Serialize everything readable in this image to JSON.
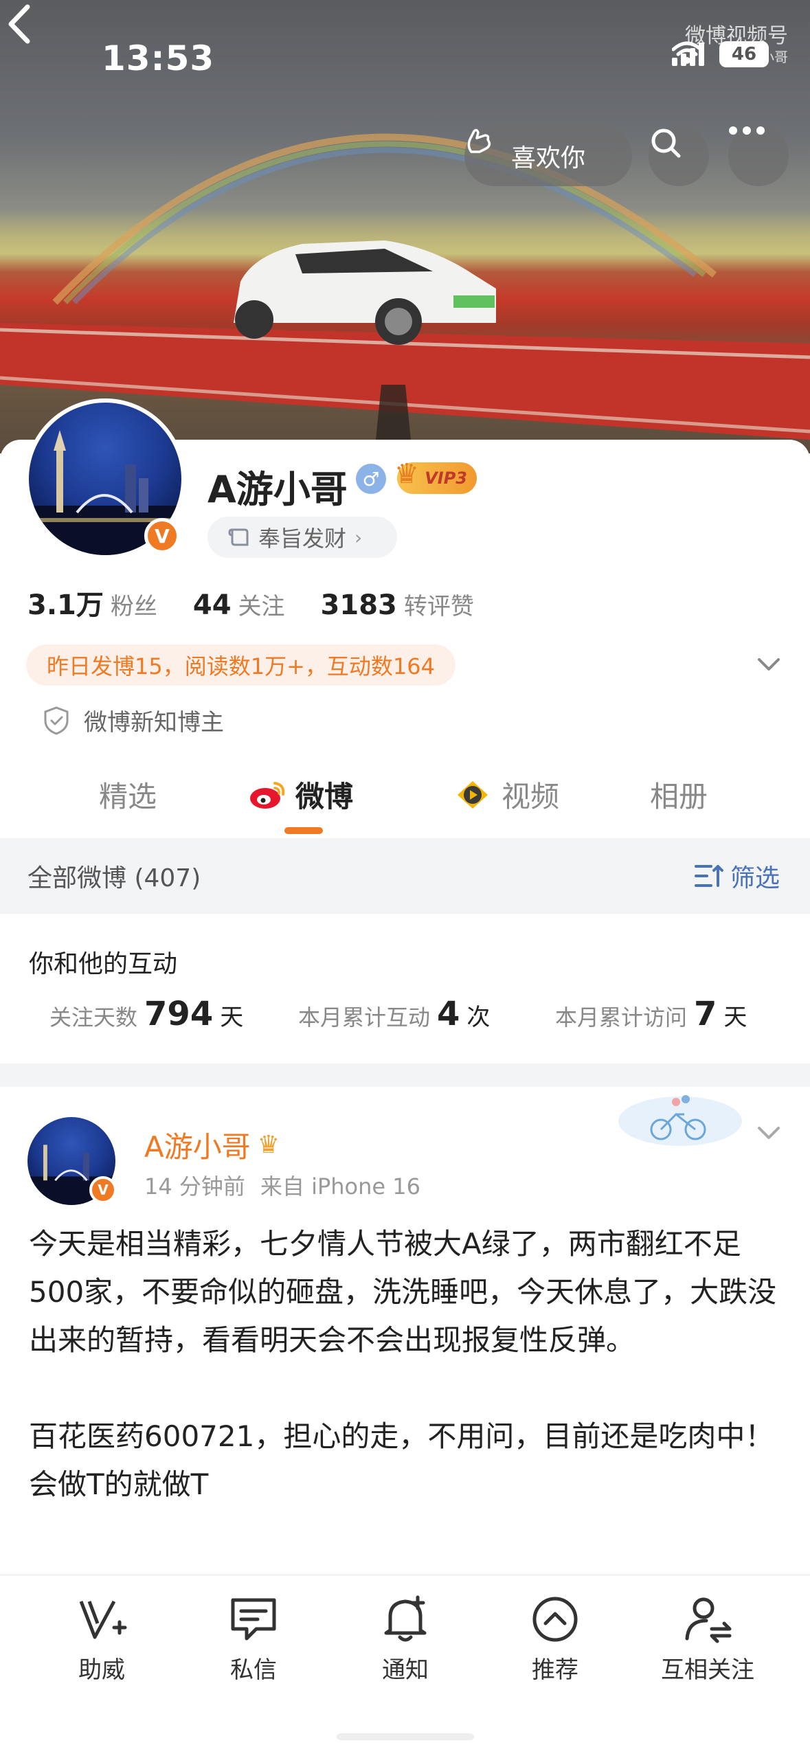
{
  "status_bar": {
    "time": "13:53",
    "battery": "46"
  },
  "watermark": {
    "line1": "微博视频号",
    "line2": "@A游小哥"
  },
  "header": {
    "like_label": "喜欢你"
  },
  "profile": {
    "name": "A游小哥",
    "vip_label": "VIP3",
    "tag_label": "奉旨发财",
    "verified_badge": "V",
    "stats": [
      {
        "value": "3.1万",
        "label": "粉丝"
      },
      {
        "value": "44",
        "label": "关注"
      },
      {
        "value": "3183",
        "label": "转评赞"
      }
    ],
    "activity_summary": "昨日发博15，阅读数1万+，互动数164",
    "new_knowledge_label": "微博新知博主"
  },
  "tabs": [
    {
      "label": "精选"
    },
    {
      "label": "微博"
    },
    {
      "label": "视频"
    },
    {
      "label": "相册"
    }
  ],
  "filter_bar": {
    "count_label": "全部微博 (407)",
    "filter_label": "筛选"
  },
  "interaction": {
    "title": "你和他的互动",
    "items": [
      {
        "label": "关注天数",
        "value": "794",
        "unit": "天"
      },
      {
        "label": "本月累计互动",
        "value": "4",
        "unit": "次"
      },
      {
        "label": "本月累计访问",
        "value": "7",
        "unit": "天"
      }
    ]
  },
  "post": {
    "author": "A游小哥",
    "time": "14 分钟前",
    "source": "来自 iPhone 16",
    "text": "今天是相当精彩，七夕情人节被大A绿了，两市翻红不足500家，不要命似的砸盘，洗洗睡吧，今天休息了，大跌没出来的暂持，看看明天会不会出现报复性反弹。\n\n百花医药600721，担心的走，不用问，目前还是吃肉中！会做T的就做T"
  },
  "bottom_nav": [
    {
      "label": "助威",
      "icon": "boost-v-icon"
    },
    {
      "label": "私信",
      "icon": "message-icon"
    },
    {
      "label": "通知",
      "icon": "bell-plus-icon"
    },
    {
      "label": "推荐",
      "icon": "recommend-up-icon"
    },
    {
      "label": "互相关注",
      "icon": "mutual-follow-icon"
    }
  ],
  "colors": {
    "accent": "#f07a23",
    "link_blue": "#4a72b8",
    "background_gray": "#f3f4f6"
  }
}
